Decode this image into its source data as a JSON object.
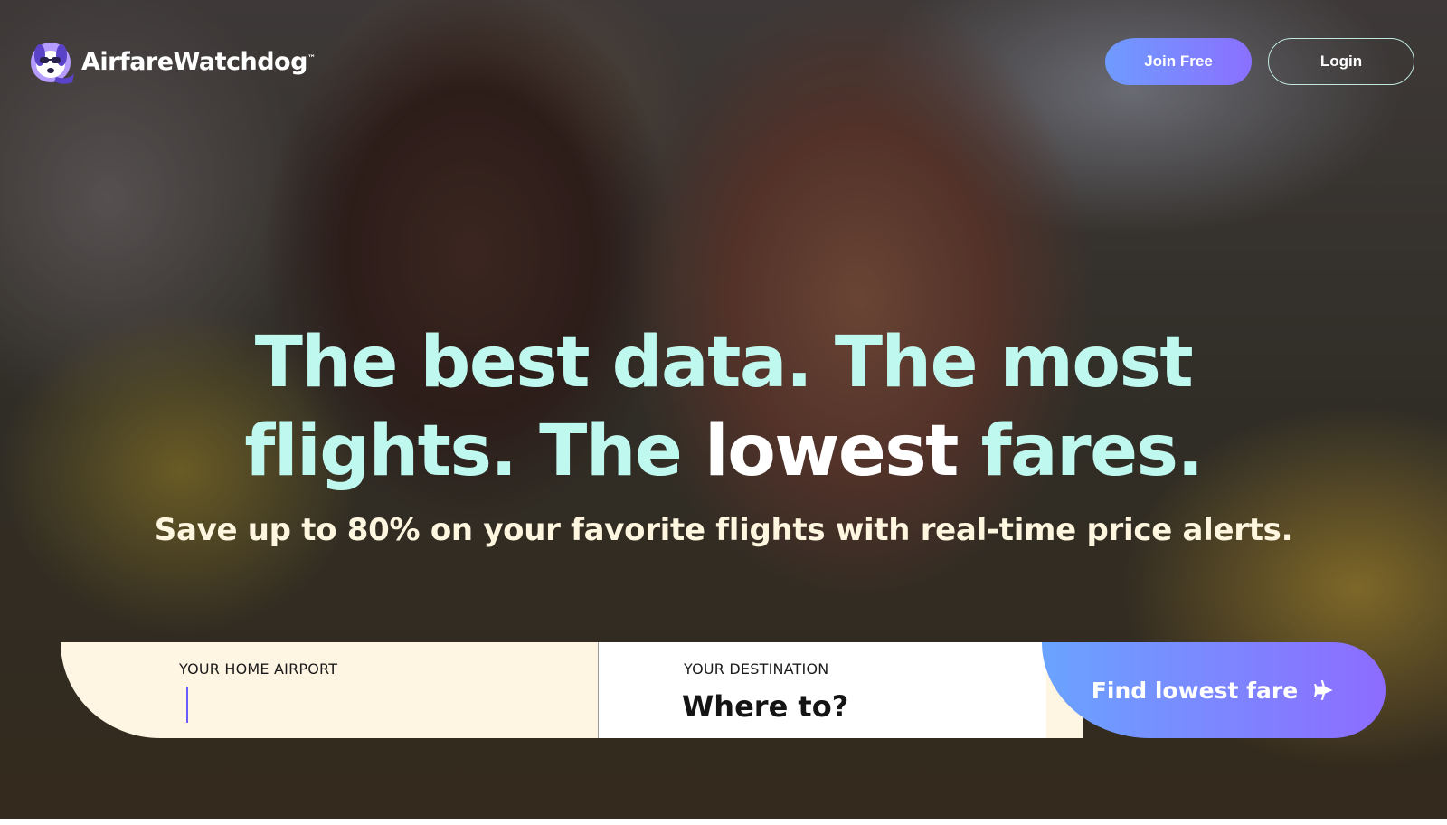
{
  "brand": {
    "name": "AirfareWatchdog",
    "trademark": "™"
  },
  "header": {
    "join_label": "Join Free",
    "login_label": "Login"
  },
  "hero": {
    "headline_part1": "The best data. The most",
    "headline_part2": "flights. The ",
    "headline_highlight": "lowest",
    "headline_part3": " fares.",
    "subheadline": "Save up to 80% on your favorite flights with real-time price alerts."
  },
  "search": {
    "home_label": "YOUR HOME AIRPORT",
    "home_value": "",
    "destination_label": "YOUR DESTINATION",
    "destination_placeholder": "Where to?",
    "submit_label": "Find lowest fare",
    "submit_icon": "airplane-icon"
  },
  "colors": {
    "headline": "#bff8ee",
    "accent_start": "#6aa3ff",
    "accent_end": "#8d6cff",
    "field_bg": "#fff5e3"
  }
}
